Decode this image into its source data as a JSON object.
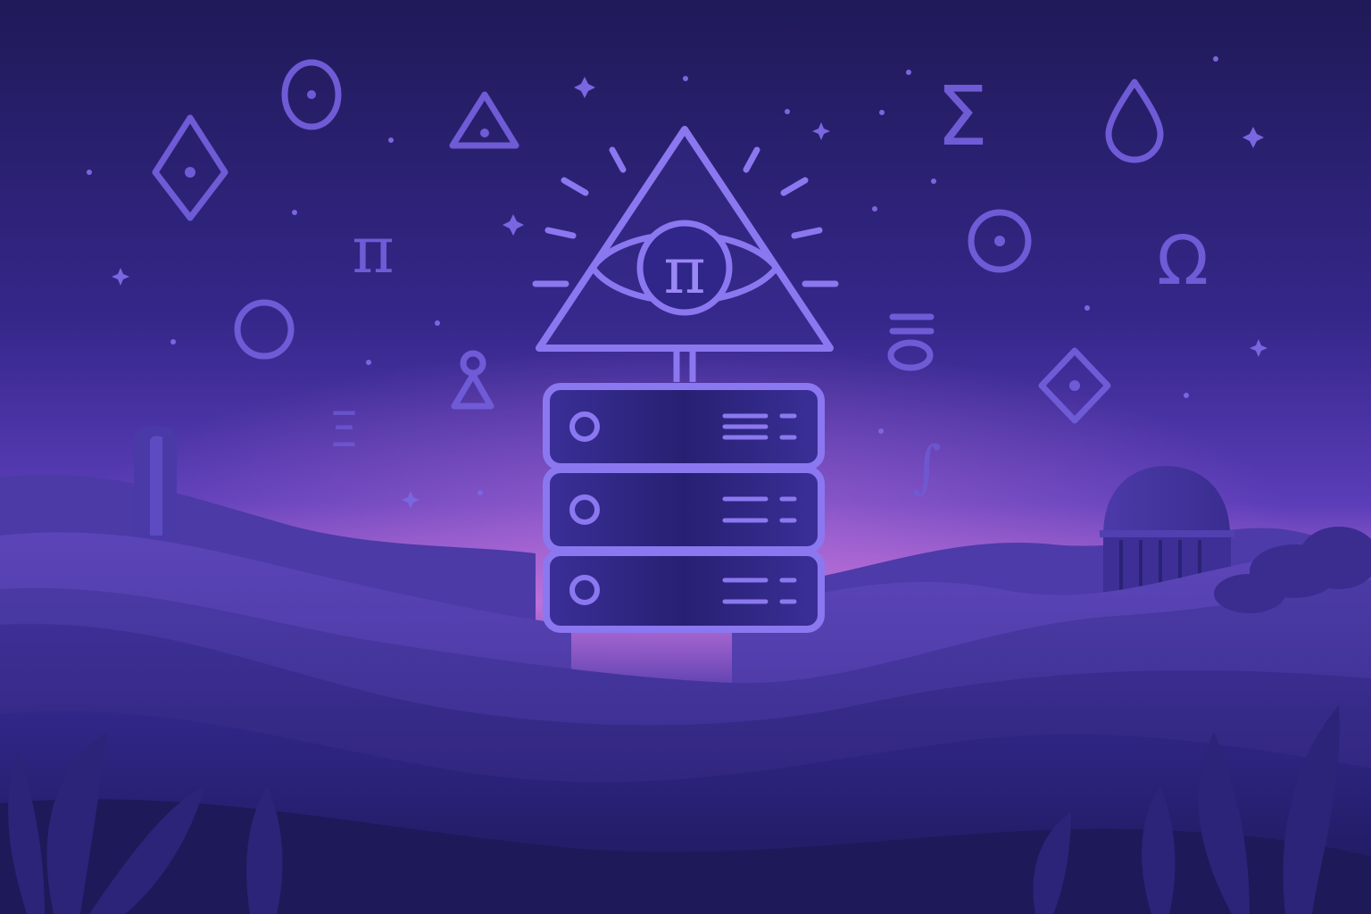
{
  "scene": {
    "description_colors": {
      "sky_top": "#211c5c",
      "sky_mid": "#4a35a3",
      "horizon_glow": "#c46fd8",
      "symbol_color": "#6f5bd6",
      "symbol_bright": "#8b78f0",
      "server_body": "#2a237a",
      "server_outline": "#8b78f0"
    }
  },
  "symbols": {
    "pi_main": "π",
    "pi_small": "π",
    "sigma": "Σ",
    "omega": "Ω",
    "xi": "Ξ",
    "integral": "∫"
  }
}
